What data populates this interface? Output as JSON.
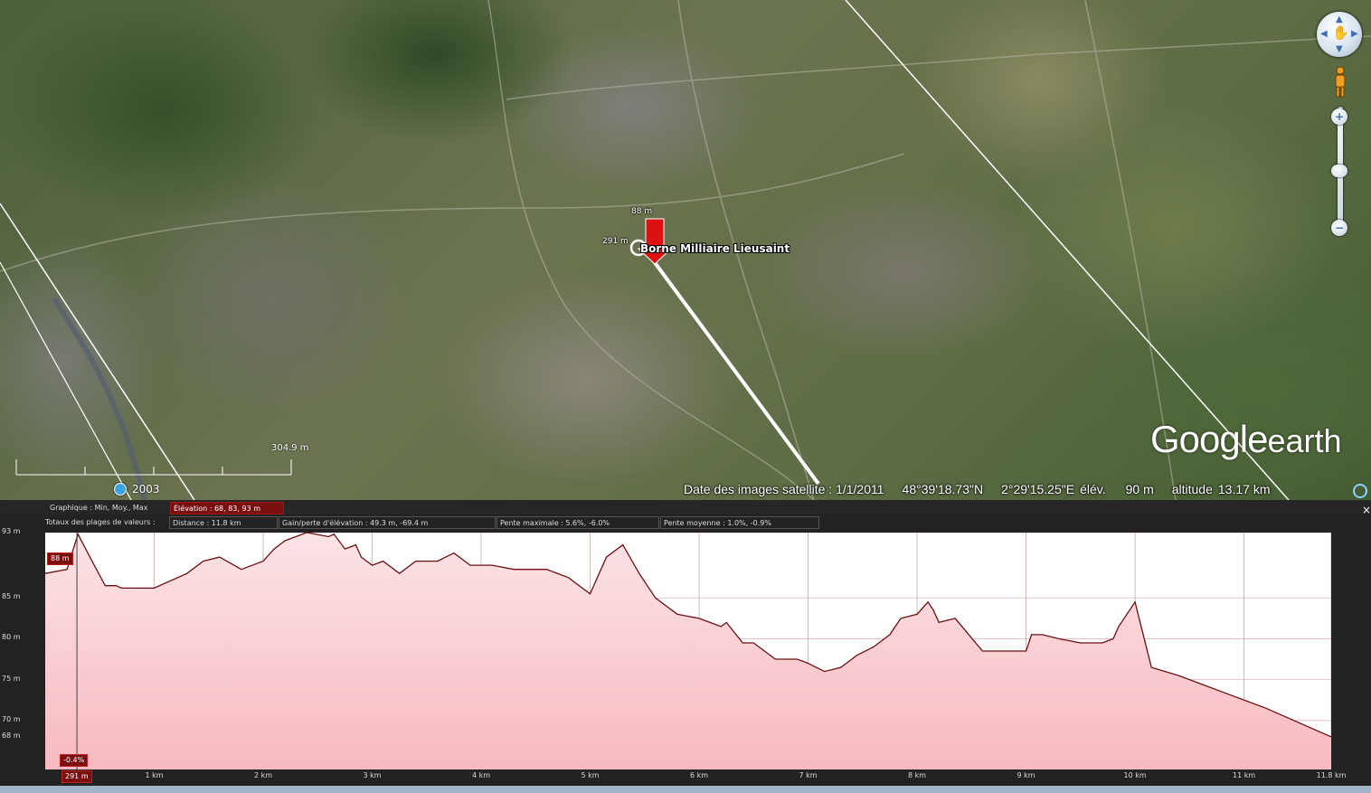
{
  "map": {
    "placemark_name": "Borne Milliaire Lieusaint",
    "placemark_elev_label": "88 m",
    "placemark_dist_label": "291 m",
    "scale_label": "304.9 m",
    "history_year": "2003",
    "status": {
      "imagery_date": "Date des images satellite : 1/1/2011",
      "latitude": "48°39'18.73\"N",
      "longitude": "2°29'15.25\"E",
      "elev_label": "élév.",
      "elev_value": "90 m",
      "altitude_label": "altitude",
      "altitude_value": "13.17 km"
    },
    "logo_google": "Google",
    "logo_earth": "earth",
    "icons": {
      "nav": "navigation-ring-icon",
      "pegman": "street-view-pegman-icon",
      "zoom_in": "+",
      "zoom_out": "−"
    }
  },
  "panel": {
    "graph_label": "Graphique : Min, Moy., Max",
    "elevation_box": "Élévation : 68, 83, 93 m",
    "totals_label": "Totaux des plages de valeurs :",
    "distance_box": "Distance : 11.8 km",
    "gain_box": "Gain/perte d'élévation : 49.3 m, -69.4 m",
    "max_slope_box": "Pente maximale : 5.6%, -6.0%",
    "avg_slope_box": "Pente moyenne : 1.0%, -0.9%",
    "close": "×",
    "cursor_elev_tag": "88 m",
    "cursor_slope_tag": "-0.4%",
    "cursor_dist_tag": "291 m"
  },
  "chart_data": {
    "type": "area",
    "xlabel": "",
    "ylabel": "",
    "xlim": [
      0,
      11.8
    ],
    "ylim": [
      64,
      93
    ],
    "y_ticks": [
      {
        "v": 93,
        "label": "93 m"
      },
      {
        "v": 85,
        "label": "85 m"
      },
      {
        "v": 80,
        "label": "80 m"
      },
      {
        "v": 75,
        "label": "75 m"
      },
      {
        "v": 70,
        "label": "70 m"
      },
      {
        "v": 68,
        "label": "68 m"
      }
    ],
    "x_ticks": [
      {
        "v": 1,
        "label": "1 km"
      },
      {
        "v": 2,
        "label": "2 km"
      },
      {
        "v": 3,
        "label": "3 km"
      },
      {
        "v": 4,
        "label": "4 km"
      },
      {
        "v": 5,
        "label": "5 km"
      },
      {
        "v": 6,
        "label": "6 km"
      },
      {
        "v": 7,
        "label": "7 km"
      },
      {
        "v": 8,
        "label": "8 km"
      },
      {
        "v": 9,
        "label": "9 km"
      },
      {
        "v": 10,
        "label": "10 km"
      },
      {
        "v": 11,
        "label": "11 km"
      },
      {
        "v": 11.8,
        "label": "11.8 km"
      }
    ],
    "grid": true,
    "series": [
      {
        "x": [
          0,
          0.2,
          0.3,
          0.45,
          0.55,
          0.65,
          0.7,
          0.8,
          1.0,
          1.3,
          1.45,
          1.6,
          1.8,
          2.0,
          2.1,
          2.2,
          2.4,
          2.6,
          2.65,
          2.75,
          2.85,
          2.9,
          3.0,
          3.1,
          3.25,
          3.4,
          3.6,
          3.75,
          3.9,
          4.1,
          4.3,
          4.6,
          4.8,
          5.0,
          5.15,
          5.3,
          5.45,
          5.6,
          5.8,
          6.0,
          6.2,
          6.25,
          6.4,
          6.5,
          6.7,
          6.9,
          7.0,
          7.15,
          7.3,
          7.45,
          7.6,
          7.75,
          7.85,
          8.0,
          8.1,
          8.15,
          8.2,
          8.35,
          8.6,
          8.65,
          8.8,
          9.0,
          9.05,
          9.15,
          9.3,
          9.5,
          9.7,
          9.8,
          9.85,
          10.0,
          10.15,
          10.4,
          10.8,
          11.2,
          11.8
        ],
        "y": [
          88,
          88.5,
          92.8,
          89,
          86.5,
          86.5,
          86.2,
          86.2,
          86.2,
          88,
          89.5,
          90,
          88.5,
          89.5,
          91,
          92,
          93,
          92.5,
          92.8,
          91,
          91.5,
          90,
          89,
          89.5,
          88,
          89.5,
          89.5,
          90.5,
          89,
          89,
          88.5,
          88.5,
          87.5,
          85.5,
          90,
          91.5,
          88,
          85,
          83,
          82.5,
          81.5,
          82,
          79.5,
          79.5,
          77.5,
          77.5,
          77,
          76,
          76.5,
          78,
          79,
          80.5,
          82.5,
          83,
          84.5,
          83.5,
          82,
          82.5,
          78.5,
          78.5,
          78.5,
          78.5,
          80.5,
          80.5,
          80,
          79.5,
          79.5,
          80,
          81.5,
          84.5,
          76.5,
          75.5,
          73.5,
          71.5,
          68
        ]
      }
    ]
  }
}
